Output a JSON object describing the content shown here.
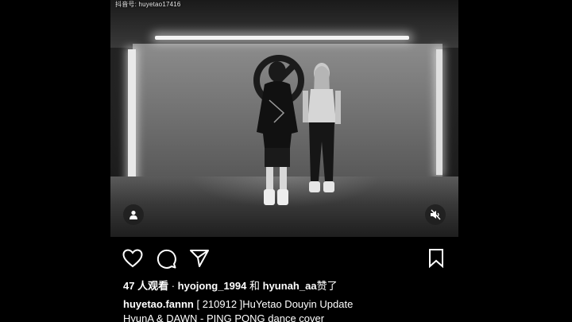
{
  "watermark": "抖音号: huyetao17416",
  "video": {
    "icons": {
      "tag": "person-tag-icon",
      "mute": "speaker-muted-icon"
    }
  },
  "actions": {
    "like": "heart-icon",
    "comment": "speech-bubble-icon",
    "share": "paper-plane-icon",
    "save": "bookmark-icon"
  },
  "likes": {
    "views": "47 人观看",
    "separator": "·",
    "user1": "hyojong_1994",
    "conj": "和",
    "user2": "hyunah_aa",
    "suffix": "赞了"
  },
  "caption": {
    "username": "huyetao.fannn",
    "line1": "[ 210912 ]HuYetao Douyin Update",
    "line2": "HyunA & DAWN - PING PONG dance cover"
  }
}
